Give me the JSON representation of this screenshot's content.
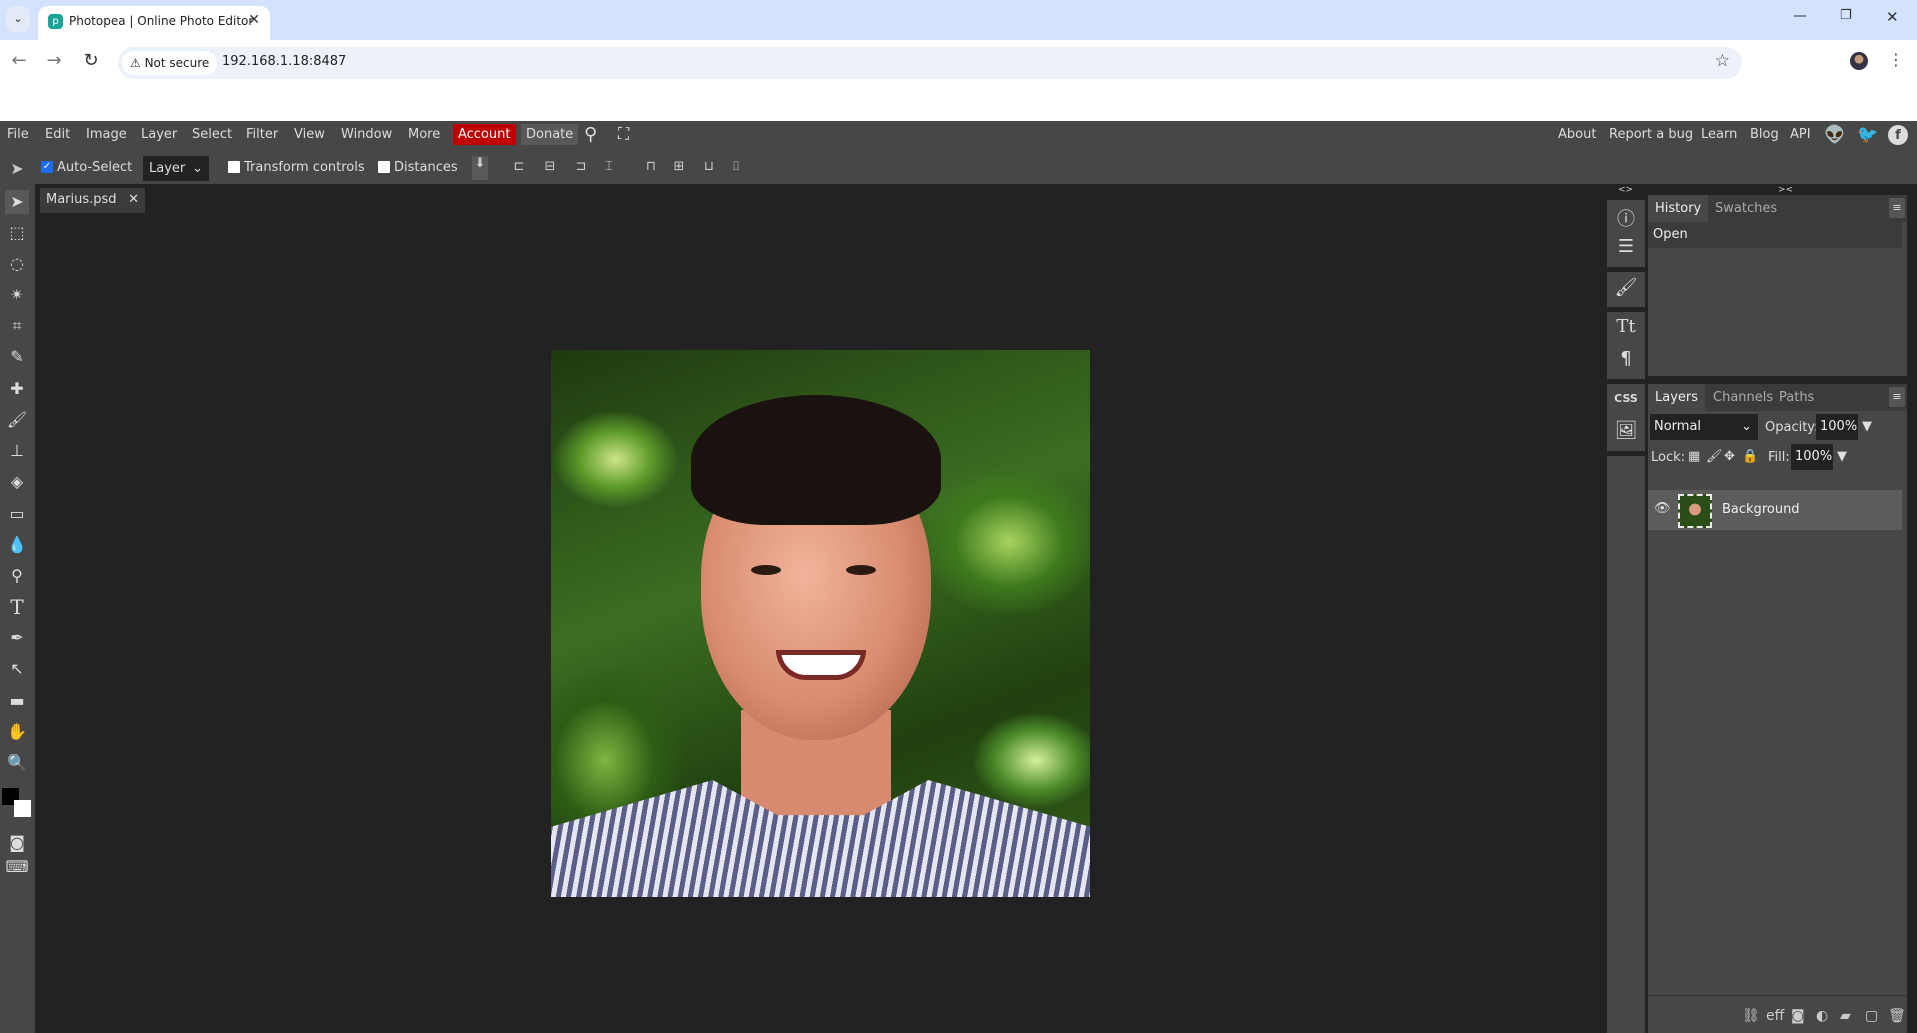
{
  "browser": {
    "tab_title": "Photopea | Online Photo Editor",
    "security_label": "Not secure",
    "url": "192.168.1.18:8487"
  },
  "menubar": {
    "items": [
      "File",
      "Edit",
      "Image",
      "Layer",
      "Select",
      "Filter",
      "View",
      "Window",
      "More"
    ],
    "account": "Account",
    "donate": "Donate",
    "right_links": [
      "About",
      "Report a bug",
      "Learn",
      "Blog",
      "API"
    ],
    "accent": "#c00000"
  },
  "options": {
    "auto_select": "Auto-Select",
    "auto_select_checked": true,
    "layer_mode": "Layer",
    "transform_controls": "Transform controls",
    "distances": "Distances"
  },
  "document": {
    "tab": "Marius.psd"
  },
  "history": {
    "tabs": [
      "History",
      "Swatches"
    ],
    "items": [
      "Open"
    ]
  },
  "layers": {
    "tabs": [
      "Layers",
      "Channels",
      "Paths"
    ],
    "blend_mode": "Normal",
    "opacity_label": "Opacity:",
    "opacity": "100%",
    "lock_label": "Lock:",
    "fill_label": "Fill:",
    "fill": "100%",
    "items": [
      {
        "name": "Background",
        "visible": true
      }
    ]
  },
  "side_icons": {
    "css": "CSS"
  },
  "footer_icons": {
    "effects": "eff"
  }
}
